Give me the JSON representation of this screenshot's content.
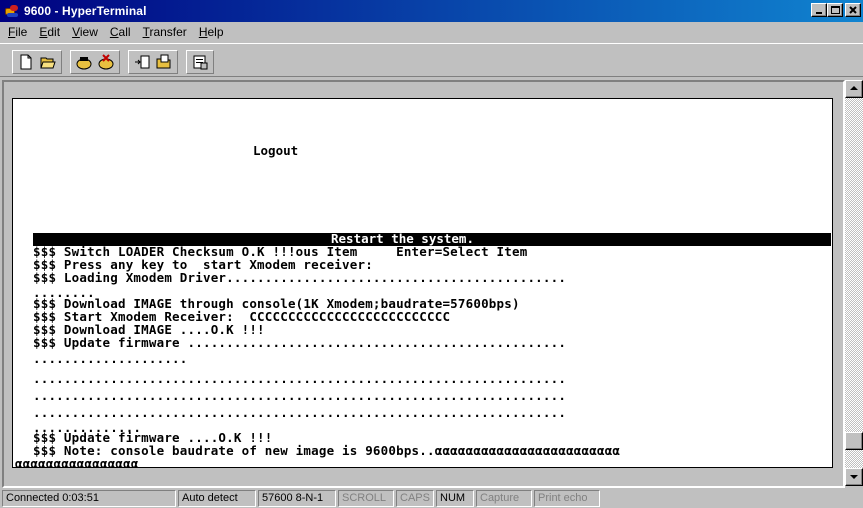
{
  "window": {
    "title": "9600 - HyperTerminal",
    "controls": [
      "minimize",
      "maximize",
      "close"
    ]
  },
  "menu": [
    {
      "label": "File",
      "underline": "F",
      "rest": "ile"
    },
    {
      "label": "Edit",
      "underline": "E",
      "rest": "dit"
    },
    {
      "label": "View",
      "underline": "V",
      "rest": "iew"
    },
    {
      "label": "Call",
      "underline": "C",
      "rest": "all"
    },
    {
      "label": "Transfer",
      "underline": "T",
      "rest": "ransfer"
    },
    {
      "label": "Help",
      "underline": "H",
      "rest": "elp"
    }
  ],
  "toolbar": {
    "icons": [
      "new-icon",
      "open-icon",
      "connect-icon",
      "disconnect-icon",
      "send-icon",
      "receive-icon",
      "properties-icon"
    ]
  },
  "terminal": {
    "heading": "Logout",
    "highlight": "Restart the system.",
    "lines": [
      "$$$ Switch LOADER Checksum O.K !!!ous Item     Enter=Select Item",
      "$$$ Press any key to  start Xmodem receiver:",
      "$$$ Loading Xmodem Driver............................................",
      "........",
      "$$$ Download IMAGE through console(1K Xmodem;baudrate=57600bps)",
      "$$$ Start Xmodem Receiver:  CCCCCCCCCCCCCCCCCCCCCCCCCC",
      "$$$ Download IMAGE ....O.K !!!",
      "$$$ Update firmware .................................................",
      "....................",
      ".....................................................................",
      ".....................................................................",
      ".....................................................................",
      "..............",
      "$$$ Update firmware ....O.K !!!",
      "$$$ Note: console baudrate of new image is 9600bps..αααααααααααααααααααααααα",
      "αααααααααααααααα"
    ]
  },
  "status": {
    "connected": "Connected 0:03:51",
    "detect": "Auto detect",
    "params": "57600 8-N-1",
    "scroll": "SCROLL",
    "caps": "CAPS",
    "num": "NUM",
    "capture": "Capture",
    "print_echo": "Print echo"
  }
}
